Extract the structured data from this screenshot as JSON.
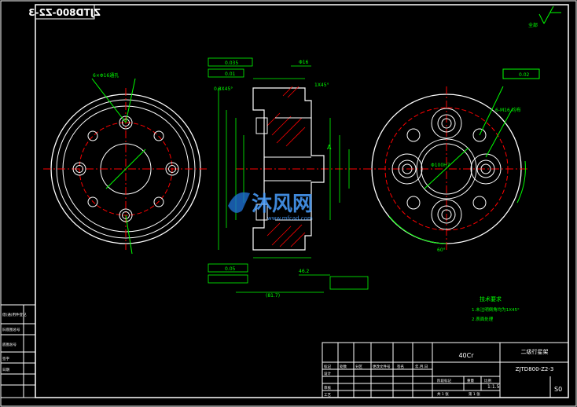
{
  "drawing": {
    "code_mirrored": "ZJTD800-Z2-3",
    "logo_text": "沐风网",
    "logo_url": "www.mfcad.com",
    "roughness_corner": "全部",
    "note_title": "技术要求",
    "notes": [
      "1.未注明倒角均为1X45°",
      "2.表面处理"
    ]
  },
  "title_block": {
    "material": "40Cr",
    "part_name": "二级行星架",
    "drawing_no": "ZJTD800-Z2-3",
    "scale": "1:1.5",
    "sheet": "S0",
    "header_cells": [
      "标记",
      "处数",
      "分区",
      "更改文件号",
      "签名",
      "年.月.日"
    ],
    "rows_left": [
      "设计",
      "审核",
      "工艺"
    ],
    "stage_labels": [
      "阶段标记",
      "重量",
      "比例"
    ],
    "sheets_label": [
      "共 1 张",
      "第 1 张"
    ]
  },
  "side_table": [
    "借(通)用件登记",
    "旧底图总号",
    "底图总号",
    "签字",
    "日期"
  ],
  "dims": {
    "flat1": "0.035",
    "flat2": "0.01",
    "chamfer1": "0.8X45°",
    "chamfer2": "1X45°",
    "ref_a": "A",
    "len1": "(81.7)",
    "len2": "46.2",
    "dia": "Φ16",
    "tol": "0.05",
    "holes_left": "6×Φ16通孔",
    "holes_right": "6-M16 均布",
    "angle": "60°",
    "dia_center": "Φ100H7",
    "flat_right": "0.02"
  }
}
